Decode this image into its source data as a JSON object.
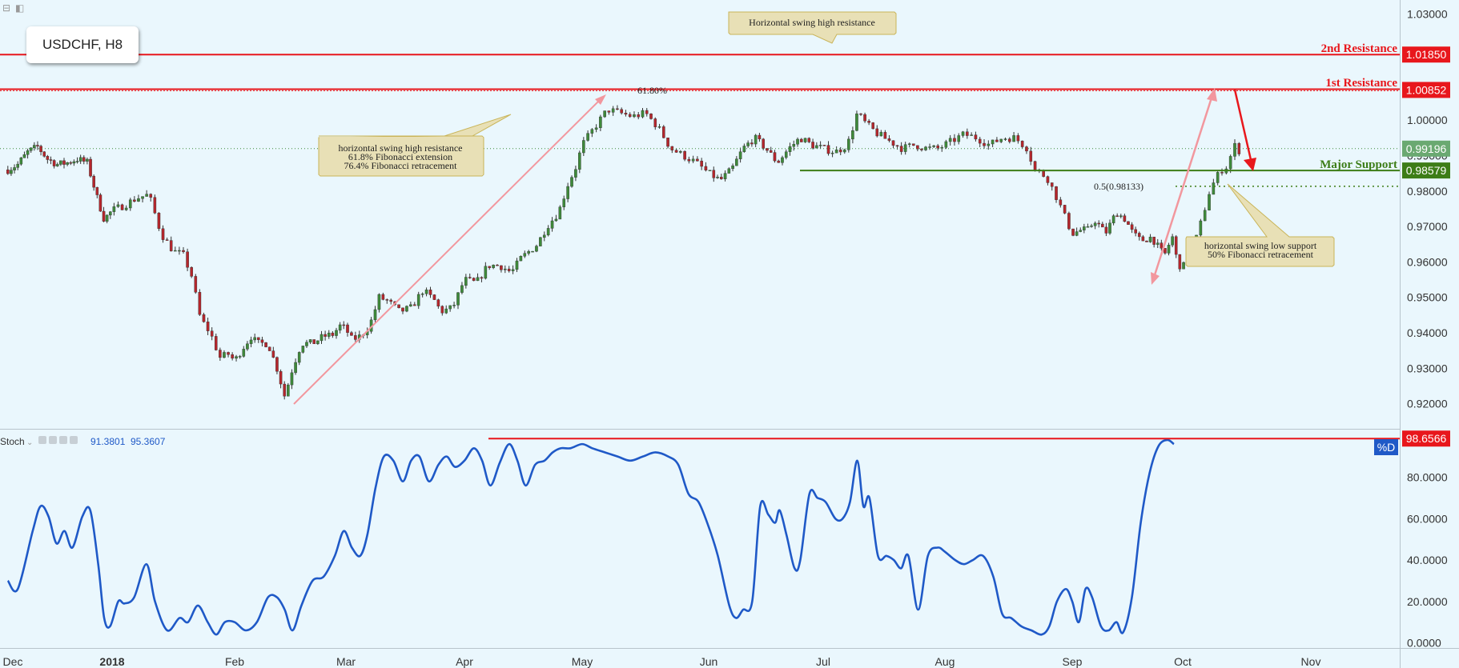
{
  "symbol_label": "USDCHF, H8",
  "toolbar_icons": [
    "collapse-icon",
    "square-icon"
  ],
  "toolbar_glyphs": [
    "⊟",
    "◧"
  ],
  "colors": {
    "background": "#eaf7fd",
    "resistance": "#e8171c",
    "support": "#3d7d17",
    "stoch": "#1f59c7",
    "bull_candle": "#3e8a3a",
    "bear_candle": "#b5262c",
    "arrow_pink": "#f2979e",
    "callout_fill": "#e8e0b6",
    "callout_stroke": "#c9b458"
  },
  "chart_data": [
    {
      "type": "candlestick",
      "pane": "price",
      "xlabels": [
        "Dec",
        "2018",
        "Feb",
        "Mar",
        "Apr",
        "May",
        "Jun",
        "Jul",
        "Aug",
        "Sep",
        "Oct",
        "Nov"
      ],
      "yticks": [
        "0.92000",
        "0.93000",
        "0.94000",
        "0.95000",
        "0.96000",
        "0.97000",
        "0.98000",
        "0.99000",
        "1.00000",
        "1.03000"
      ],
      "ylim": [
        0.9129,
        1.0339
      ],
      "x_months": [
        0,
        1,
        2,
        3,
        4,
        5,
        6,
        7,
        8,
        9,
        10,
        11
      ],
      "close_path": [
        [
          -0.05,
          0.986
        ],
        [
          0.05,
          0.9875
        ],
        [
          0.15,
          0.991
        ],
        [
          0.25,
          0.9925
        ],
        [
          0.35,
          0.989
        ],
        [
          0.45,
          0.9875
        ],
        [
          0.55,
          0.988
        ],
        [
          0.65,
          0.989
        ],
        [
          0.75,
          0.988
        ],
        [
          0.85,
          0.978
        ],
        [
          0.92,
          0.972
        ],
        [
          1.0,
          0.9745
        ],
        [
          1.1,
          0.976
        ],
        [
          1.2,
          0.978
        ],
        [
          1.3,
          0.979
        ],
        [
          1.4,
          0.968
        ],
        [
          1.5,
          0.963
        ],
        [
          1.58,
          0.962
        ],
        [
          1.65,
          0.956
        ],
        [
          1.72,
          0.944
        ],
        [
          1.8,
          0.94
        ],
        [
          1.88,
          0.933
        ],
        [
          1.95,
          0.934
        ],
        [
          2.0,
          0.932
        ],
        [
          2.08,
          0.936
        ],
        [
          2.15,
          0.939
        ],
        [
          2.2,
          0.937
        ],
        [
          2.3,
          0.937
        ],
        [
          2.38,
          0.93
        ],
        [
          2.45,
          0.922
        ],
        [
          2.52,
          0.93
        ],
        [
          2.6,
          0.937
        ],
        [
          2.7,
          0.937
        ],
        [
          2.8,
          0.939
        ],
        [
          2.88,
          0.9395
        ],
        [
          2.95,
          0.942
        ],
        [
          3.0,
          0.941
        ],
        [
          3.05,
          0.938
        ],
        [
          3.12,
          0.939
        ],
        [
          3.2,
          0.942
        ],
        [
          3.28,
          0.95
        ],
        [
          3.35,
          0.949
        ],
        [
          3.45,
          0.946
        ],
        [
          3.55,
          0.947
        ],
        [
          3.65,
          0.952
        ],
        [
          3.75,
          0.949
        ],
        [
          3.8,
          0.946
        ],
        [
          3.9,
          0.947
        ],
        [
          4.0,
          0.955
        ],
        [
          4.1,
          0.954
        ],
        [
          4.2,
          0.959
        ],
        [
          4.3,
          0.959
        ],
        [
          4.4,
          0.957
        ],
        [
          4.48,
          0.961
        ],
        [
          4.55,
          0.963
        ],
        [
          4.62,
          0.965
        ],
        [
          4.7,
          0.97
        ],
        [
          4.8,
          0.974
        ],
        [
          4.88,
          0.982
        ],
        [
          4.95,
          0.987
        ],
        [
          5.0,
          0.993
        ],
        [
          5.1,
          0.998
        ],
        [
          5.2,
          1.003
        ],
        [
          5.3,
          1.002
        ],
        [
          5.4,
          1.001
        ],
        [
          5.5,
          1.002
        ],
        [
          5.6,
          0.998
        ],
        [
          5.7,
          0.992
        ],
        [
          5.8,
          0.99
        ],
        [
          5.9,
          0.988
        ],
        [
          6.0,
          0.985
        ],
        [
          6.1,
          0.983
        ],
        [
          6.2,
          0.986
        ],
        [
          6.3,
          0.992
        ],
        [
          6.4,
          0.995
        ],
        [
          6.5,
          0.992
        ],
        [
          6.6,
          0.988
        ],
        [
          6.7,
          0.992
        ],
        [
          6.8,
          0.995
        ],
        [
          6.9,
          0.993
        ],
        [
          7.0,
          0.992
        ],
        [
          7.1,
          0.991
        ],
        [
          7.2,
          0.993
        ],
        [
          7.28,
          1.002
        ],
        [
          7.35,
          0.999
        ],
        [
          7.45,
          0.996
        ],
        [
          7.55,
          0.994
        ],
        [
          7.65,
          0.992
        ],
        [
          7.75,
          0.993
        ],
        [
          7.85,
          0.992
        ],
        [
          7.95,
          0.992
        ],
        [
          8.05,
          0.994
        ],
        [
          8.15,
          0.996
        ],
        [
          8.25,
          0.995
        ],
        [
          8.35,
          0.993
        ],
        [
          8.45,
          0.995
        ],
        [
          8.55,
          0.995
        ],
        [
          8.65,
          0.992
        ],
        [
          8.7,
          0.986
        ],
        [
          8.8,
          0.984
        ],
        [
          8.88,
          0.978
        ],
        [
          8.95,
          0.972
        ],
        [
          9.0,
          0.968
        ],
        [
          9.08,
          0.969
        ],
        [
          9.15,
          0.969
        ],
        [
          9.2,
          0.972
        ],
        [
          9.3,
          0.968
        ],
        [
          9.4,
          0.974
        ],
        [
          9.48,
          0.972
        ],
        [
          9.55,
          0.968
        ],
        [
          9.62,
          0.966
        ],
        [
          9.72,
          0.967
        ],
        [
          9.8,
          0.963
        ],
        [
          9.85,
          0.962
        ],
        [
          9.9,
          0.968
        ],
        [
          9.95,
          0.96
        ],
        [
          10.0,
          0.958
        ],
        [
          10.05,
          0.964
        ],
        [
          10.1,
          0.966
        ],
        [
          10.15,
          0.972
        ],
        [
          10.2,
          0.979
        ],
        [
          10.25,
          0.983
        ],
        [
          10.3,
          0.986
        ],
        [
          10.35,
          0.987
        ],
        [
          10.4,
          0.993
        ],
        [
          10.45,
          0.991
        ]
      ]
    },
    {
      "type": "line",
      "pane": "stochastic",
      "yticks": [
        "0.0000",
        "20.0000",
        "40.0000",
        "60.0000",
        "80.0000"
      ],
      "ylim": [
        -2.5,
        103
      ],
      "x_months": [
        0,
        1,
        2,
        3,
        4,
        5,
        6,
        7,
        8,
        9,
        10,
        11
      ],
      "points": [
        [
          -0.05,
          30
        ],
        [
          0.05,
          26
        ],
        [
          0.2,
          54
        ],
        [
          0.28,
          66
        ],
        [
          0.36,
          61
        ],
        [
          0.44,
          48
        ],
        [
          0.52,
          54
        ],
        [
          0.6,
          46
        ],
        [
          0.7,
          61
        ],
        [
          0.78,
          64
        ],
        [
          0.86,
          38
        ],
        [
          0.92,
          12
        ],
        [
          0.98,
          8
        ],
        [
          1.05,
          20
        ],
        [
          1.1,
          19
        ],
        [
          1.18,
          22
        ],
        [
          1.28,
          38
        ],
        [
          1.35,
          20
        ],
        [
          1.45,
          6
        ],
        [
          1.55,
          12
        ],
        [
          1.62,
          10
        ],
        [
          1.7,
          18
        ],
        [
          1.78,
          10
        ],
        [
          1.85,
          4
        ],
        [
          1.92,
          10
        ],
        [
          2.0,
          10
        ],
        [
          2.1,
          6
        ],
        [
          2.2,
          10
        ],
        [
          2.3,
          22
        ],
        [
          2.38,
          22
        ],
        [
          2.45,
          16
        ],
        [
          2.52,
          6
        ],
        [
          2.6,
          18
        ],
        [
          2.7,
          30
        ],
        [
          2.8,
          32
        ],
        [
          2.9,
          42
        ],
        [
          2.98,
          54
        ],
        [
          3.05,
          46
        ],
        [
          3.12,
          42
        ],
        [
          3.18,
          52
        ],
        [
          3.25,
          75
        ],
        [
          3.32,
          90
        ],
        [
          3.4,
          88
        ],
        [
          3.48,
          78
        ],
        [
          3.55,
          88
        ],
        [
          3.62,
          90
        ],
        [
          3.7,
          78
        ],
        [
          3.78,
          86
        ],
        [
          3.85,
          90
        ],
        [
          3.92,
          85
        ],
        [
          4.0,
          88
        ],
        [
          4.08,
          94
        ],
        [
          4.15,
          88
        ],
        [
          4.22,
          76
        ],
        [
          4.3,
          87
        ],
        [
          4.38,
          96
        ],
        [
          4.45,
          88
        ],
        [
          4.52,
          76
        ],
        [
          4.6,
          86
        ],
        [
          4.68,
          88
        ],
        [
          4.75,
          92
        ],
        [
          4.82,
          94
        ],
        [
          4.9,
          94
        ],
        [
          5.0,
          96
        ],
        [
          5.08,
          94
        ],
        [
          5.18,
          92
        ],
        [
          5.28,
          90
        ],
        [
          5.38,
          88
        ],
        [
          5.48,
          90
        ],
        [
          5.58,
          92
        ],
        [
          5.68,
          90
        ],
        [
          5.76,
          86
        ],
        [
          5.84,
          72
        ],
        [
          5.92,
          68
        ],
        [
          6.0,
          56
        ],
        [
          6.08,
          42
        ],
        [
          6.18,
          18
        ],
        [
          6.24,
          12
        ],
        [
          6.3,
          16
        ],
        [
          6.38,
          20
        ],
        [
          6.45,
          66
        ],
        [
          6.52,
          62
        ],
        [
          6.58,
          58
        ],
        [
          6.62,
          64
        ],
        [
          6.68,
          52
        ],
        [
          6.75,
          36
        ],
        [
          6.8,
          40
        ],
        [
          6.88,
          72
        ],
        [
          6.95,
          70
        ],
        [
          7.02,
          68
        ],
        [
          7.1,
          60
        ],
        [
          7.16,
          60
        ],
        [
          7.22,
          68
        ],
        [
          7.28,
          88
        ],
        [
          7.33,
          66
        ],
        [
          7.38,
          70
        ],
        [
          7.45,
          42
        ],
        [
          7.52,
          42
        ],
        [
          7.58,
          40
        ],
        [
          7.64,
          36
        ],
        [
          7.7,
          42
        ],
        [
          7.78,
          16
        ],
        [
          7.86,
          42
        ],
        [
          7.94,
          46
        ],
        [
          8.0,
          44
        ],
        [
          8.08,
          40
        ],
        [
          8.15,
          38
        ],
        [
          8.22,
          40
        ],
        [
          8.3,
          42
        ],
        [
          8.38,
          32
        ],
        [
          8.45,
          14
        ],
        [
          8.52,
          12
        ],
        [
          8.6,
          8
        ],
        [
          8.68,
          6
        ],
        [
          8.76,
          4
        ],
        [
          8.82,
          8
        ],
        [
          8.88,
          20
        ],
        [
          8.95,
          26
        ],
        [
          9.0,
          20
        ],
        [
          9.06,
          10
        ],
        [
          9.12,
          26
        ],
        [
          9.18,
          22
        ],
        [
          9.26,
          8
        ],
        [
          9.33,
          6
        ],
        [
          9.4,
          10
        ],
        [
          9.46,
          5
        ],
        [
          9.54,
          22
        ],
        [
          9.62,
          58
        ],
        [
          9.7,
          82
        ],
        [
          9.78,
          95
        ],
        [
          9.86,
          98
        ],
        [
          9.92,
          96
        ]
      ],
      "legend": {
        "name": "Stoch",
        "values": [
          "91.3801",
          "95.3607"
        ]
      }
    }
  ],
  "levels": {
    "second_resistance": {
      "label": "2nd Resistance",
      "price": "1.01850",
      "value": 1.0185
    },
    "first_resistance": {
      "label": "1st Resistance",
      "price": "1.00852",
      "value": 1.00852
    },
    "major_support": {
      "label": "Major Support",
      "price": "0.98579",
      "value": 0.98579
    },
    "current_price": {
      "price": "0.99196",
      "value": 0.99196
    },
    "fib_level": {
      "label": "0.5(0.98133)",
      "value": 0.98133
    },
    "fib_top_label": "61.80%",
    "stoch_level": {
      "price": "98.6566",
      "value": 98.6566
    },
    "stoch_tag": "%D"
  },
  "annotations": {
    "top_callout": "Horizontal swing high resistance",
    "left_callout": [
      "horizontal swing high resistance",
      "61.8% Fibonacci extension",
      "76.4% Fibonacci retracement"
    ],
    "right_callout": [
      "horizontal swing low support",
      "50% Fibonacci retracement"
    ]
  }
}
